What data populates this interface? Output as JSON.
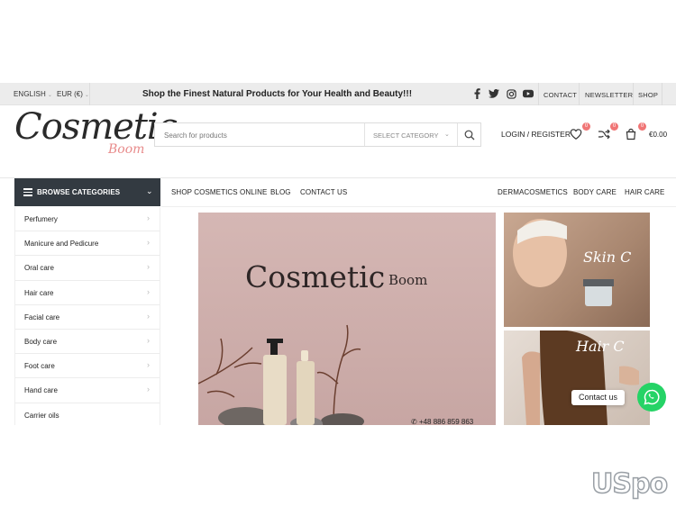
{
  "topbar": {
    "language": "ENGLISH",
    "currency": "EUR (€)",
    "promo": "Shop the Finest Natural Products for Your Health and Beauty!!!",
    "social": [
      "facebook-icon",
      "twitter-icon",
      "instagram-icon",
      "youtube-icon"
    ],
    "links": [
      "CONTACT",
      "NEWSLETTER",
      "SHOP"
    ]
  },
  "header": {
    "logo_main": "Cosmetic",
    "logo_sub": "Boom",
    "search_placeholder": "Search for products",
    "select_category": "SELECT CATEGORY",
    "login": "LOGIN / REGISTER",
    "wishlist_count": "0",
    "compare_count": "0",
    "cart_count": "0",
    "cart_total": "€0.00"
  },
  "nav": {
    "browse": "BROWSE CATEGORIES",
    "left_links": [
      "SHOP COSMETICS ONLINE",
      "BLOG",
      "CONTACT US"
    ],
    "right_links": [
      "DERMACOSMETICS",
      "BODY CARE",
      "HAIR CARE"
    ]
  },
  "categories": [
    "Perfumery",
    "Manicure and Pedicure",
    "Oral care",
    "Hair care",
    "Facial care",
    "Body care",
    "Foot care",
    "Hand care",
    "Carrier oils"
  ],
  "hero": {
    "title": "Cosmetic",
    "title_sub": "Boom",
    "phone": "+48 886 859 863"
  },
  "promos": {
    "skin": "Skin C",
    "hair": "Hair C"
  },
  "contact": {
    "label": "Contact us"
  },
  "watermark": "USpo",
  "colors": {
    "accent": "#f07575",
    "dark": "#333a41",
    "whatsapp": "#25d366"
  }
}
